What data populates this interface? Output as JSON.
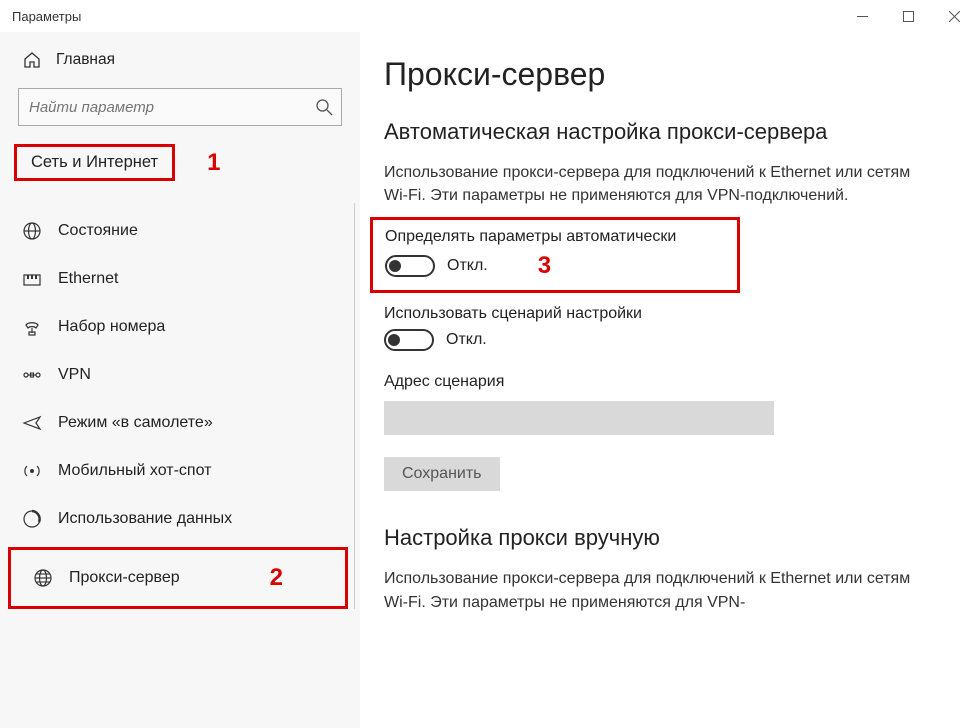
{
  "window": {
    "title": "Параметры"
  },
  "sidebar": {
    "home": "Главная",
    "search_placeholder": "Найти параметр",
    "section": "Сеть и Интернет",
    "annotation1": "1",
    "annotation2": "2",
    "items": [
      {
        "label": "Состояние"
      },
      {
        "label": "Ethernet"
      },
      {
        "label": "Набор номера"
      },
      {
        "label": "VPN"
      },
      {
        "label": "Режим «в самолете»"
      },
      {
        "label": "Мобильный хот-спот"
      },
      {
        "label": "Использование данных"
      },
      {
        "label": "Прокси-сервер"
      }
    ]
  },
  "content": {
    "title": "Прокси-сервер",
    "auto_section": "Автоматическая настройка прокси-сервера",
    "auto_desc": "Использование прокси-сервера для подключений к Ethernet или сетям Wi-Fi. Эти параметры не применяются для VPN-подключений.",
    "auto_detect_label": "Определять параметры автоматически",
    "auto_detect_state": "Откл.",
    "annotation3": "3",
    "use_script_label": "Использовать сценарий настройки",
    "use_script_state": "Откл.",
    "script_address_label": "Адрес сценария",
    "save_label": "Сохранить",
    "manual_section": "Настройка прокси вручную",
    "manual_desc": "Использование прокси-сервера для подключений к Ethernet или сетям Wi-Fi. Эти параметры не применяются для VPN-"
  }
}
